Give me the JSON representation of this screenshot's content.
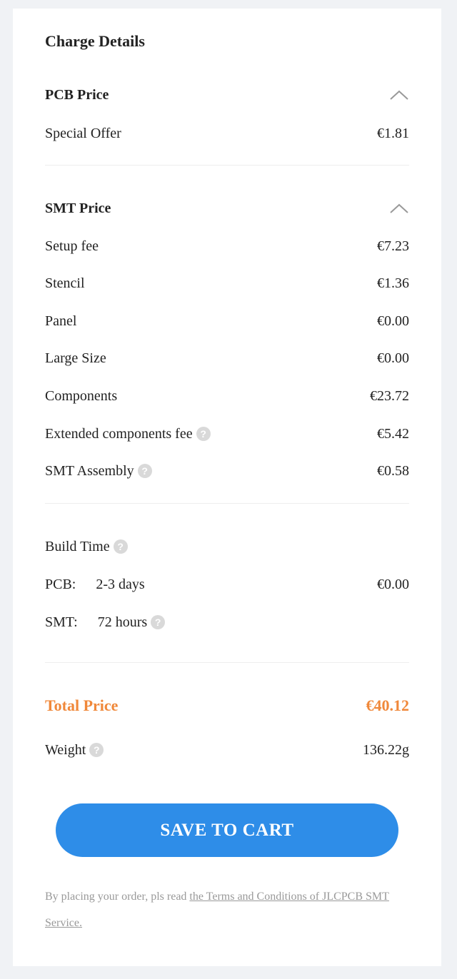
{
  "charge_details": {
    "title": "Charge Details",
    "pcb": {
      "heading": "PCB Price",
      "items": [
        {
          "label": "Special Offer",
          "value": "€1.81"
        }
      ]
    },
    "smt": {
      "heading": "SMT Price",
      "items": [
        {
          "label": "Setup fee",
          "value": "€7.23"
        },
        {
          "label": "Stencil",
          "value": "€1.36"
        },
        {
          "label": "Panel",
          "value": "€0.00"
        },
        {
          "label": "Large Size",
          "value": "€0.00"
        },
        {
          "label": "Components",
          "value": "€23.72"
        },
        {
          "label": "Extended components fee",
          "value": "€5.42"
        },
        {
          "label": "SMT Assembly",
          "value": "€0.58"
        }
      ]
    },
    "build_time": {
      "label": "Build Time",
      "pcb": {
        "label": "PCB:",
        "time": "2-3 days",
        "value": "€0.00"
      },
      "smt": {
        "label": "SMT:",
        "time": "72 hours"
      }
    },
    "total": {
      "label": "Total Price",
      "value": "€40.12"
    },
    "weight": {
      "label": "Weight",
      "value": "136.22g"
    },
    "save_button_label": "SAVE TO CART",
    "footer": {
      "text": "By placing your order, pls read ",
      "link": "the Terms and Conditions of JLCPCB SMT Service."
    },
    "help_glyph": "?",
    "colors": {
      "accent": "#f0883a",
      "button": "#2e8de8",
      "background": "#f0f2f5"
    }
  }
}
